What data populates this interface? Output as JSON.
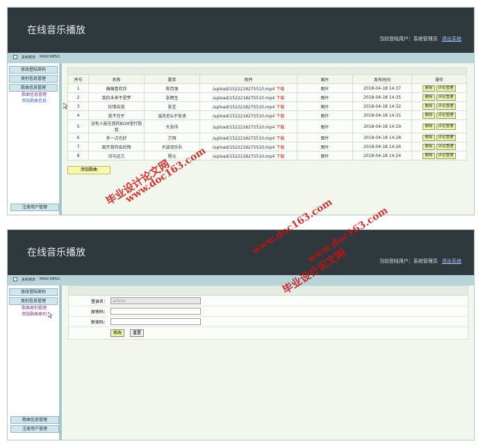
{
  "app_title": "在线音乐播放",
  "user_label": "当前登陆用户：系统管理员",
  "logout": "退出系统",
  "strip_title": "系统菜单",
  "strip_subtitle": "MAIN MENU",
  "panel1": {
    "sidebar": {
      "buttons": [
        "修改登陆密码",
        "类别信息管理",
        "歌曲信息管理"
      ],
      "links": [
        "歌曲信息管理",
        "添加歌曲信息"
      ],
      "bottom_buttons": [
        "注册用户管理"
      ]
    },
    "table": {
      "headers": [
        "序号",
        "名称",
        "歌手",
        "附件",
        "图片",
        "发布时间",
        "操作"
      ],
      "rows": [
        {
          "no": "1",
          "name": "偏偏喜欢你",
          "singer": "陈百强",
          "file": "/upload/1522218275510.mp4",
          "dl": "下载",
          "img": "图片",
          "time": "2018-04-18 14:37"
        },
        {
          "no": "2",
          "name": "我的未来不是梦",
          "singer": "张雨生",
          "file": "/upload/1522218275510.mp4",
          "dl": "下载",
          "img": "图片",
          "time": "2018-04-18 14:35"
        },
        {
          "no": "3",
          "name": "珍惜自我",
          "singer": "张艺",
          "file": "/upload/1522218275510.mp4",
          "dl": "下载",
          "img": "图片",
          "time": "2018-04-18 14:32"
        },
        {
          "no": "4",
          "name": "我不在乎",
          "singer": "温兆伦&于安迪",
          "file": "/upload/1522218275510.mp4",
          "dl": "下载",
          "img": "图片",
          "time": "2018-04-18 14:31"
        },
        {
          "no": "5",
          "name": "没有人能在我的BGM里打败我",
          "singer": "大张伟",
          "file": "/upload/1522218275510.mp4",
          "dl": "下载",
          "img": "图片",
          "time": "2018-04-18 14:29"
        },
        {
          "no": "6",
          "name": "多一点也好",
          "singer": "方铜",
          "file": "/upload/1522218275510.mp4",
          "dl": "下载",
          "img": "图片",
          "time": "2018-04-18 14:28"
        },
        {
          "no": "7",
          "name": "离开我你会后悔",
          "singer": "大波浪乐队",
          "file": "/upload/1522218275510.mp4",
          "dl": "下载",
          "img": "图片",
          "time": "2018-04-18 14:26"
        },
        {
          "no": "8",
          "name": "诗与远方",
          "singer": "程元",
          "file": "/upload/1522218275510.mp4",
          "dl": "下载",
          "img": "图片",
          "time": "2018-04-18 14:24"
        }
      ],
      "op_delete": "删除",
      "op_comment": "评论管理"
    },
    "add_button": "添加歌曲"
  },
  "panel2": {
    "sidebar": {
      "buttons": [
        "修改登陆密码",
        "类别信息管理"
      ],
      "links": [
        "歌曲类别管理",
        "添加歌曲类别"
      ],
      "bottom_buttons": [
        "歌曲信息管理",
        "注册用户管理"
      ]
    },
    "form": {
      "login_label": "登录名：",
      "login_value": "admin",
      "old_pwd_label": "原密码：",
      "new_pwd_label": "新密码：",
      "submit": "修改",
      "reset": "重置"
    }
  },
  "watermark_cn": "毕业设计论文网",
  "watermark_url": "www.doc163.com"
}
